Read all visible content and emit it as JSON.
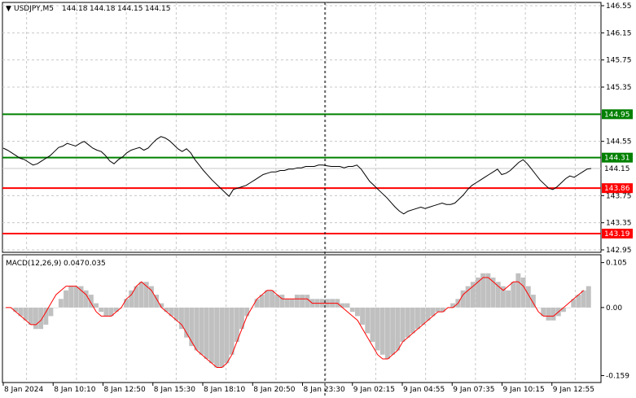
{
  "window": {
    "symbol_tf": "USDJPY,M5",
    "ohlc": [
      "144.18",
      "144.18",
      "144.15",
      "144.15"
    ]
  },
  "indicator": {
    "label": "MACD(12,26,9)",
    "values": [
      "0.047",
      "0.035"
    ]
  },
  "colors": {
    "background": "#ffffff",
    "grid": "#c8c8c8",
    "price_line": "#000000",
    "green_level": "#008000",
    "red_level": "#ff0000",
    "histogram": "#c0c0c0",
    "signal": "#ff0000"
  },
  "chart_data": [
    {
      "type": "line",
      "ylim": [
        142.95,
        146.55
      ],
      "y_ticks": [
        "146.55",
        "146.15",
        "145.75",
        "145.35",
        "144.55",
        "143.75",
        "143.35",
        "142.95"
      ],
      "x_labels": [
        "8 Jan 2024",
        "8 Jan 10:10",
        "8 Jan 12:50",
        "8 Jan 15:30",
        "8 Jan 18:10",
        "8 Jan 20:50",
        "8 Jan 23:30",
        "9 Jan 02:15",
        "9 Jan 04:55",
        "9 Jan 07:35",
        "9 Jan 10:15",
        "9 Jan 12:55"
      ],
      "current_price": "144.15",
      "levels": [
        {
          "value": 144.95,
          "label": "144.95",
          "color": "#008000"
        },
        {
          "value": 144.31,
          "label": "144.31",
          "color": "#008000"
        },
        {
          "value": 143.86,
          "label": "143.86",
          "color": "#ff0000"
        },
        {
          "value": 143.19,
          "label": "143.19",
          "color": "#ff0000"
        }
      ],
      "series": [
        {
          "values": [
            144.45,
            144.42,
            144.38,
            144.34,
            144.3,
            144.28,
            144.24,
            144.2,
            144.22,
            144.26,
            144.3,
            144.34,
            144.4,
            144.46,
            144.48,
            144.52,
            144.5,
            144.48,
            144.52,
            144.55,
            144.5,
            144.45,
            144.42,
            144.4,
            144.34,
            144.26,
            144.22,
            144.28,
            144.32,
            144.38,
            144.42,
            144.44,
            144.46,
            144.42,
            144.45,
            144.52,
            144.58,
            144.62,
            144.6,
            144.56,
            144.5,
            144.44,
            144.4,
            144.44,
            144.38,
            144.28,
            144.2,
            144.12,
            144.05,
            143.98,
            143.92,
            143.86,
            143.8,
            143.74,
            143.84,
            143.86,
            143.88,
            143.9,
            143.94,
            143.98,
            144.02,
            144.06,
            144.08,
            144.1,
            144.1,
            144.12,
            144.12,
            144.14,
            144.14,
            144.16,
            144.16,
            144.18,
            144.18,
            144.18,
            144.2,
            144.2,
            144.19,
            144.18,
            144.18,
            144.18,
            144.16,
            144.18,
            144.18,
            144.2,
            144.14,
            144.05,
            143.96,
            143.9,
            143.84,
            143.78,
            143.72,
            143.65,
            143.58,
            143.52,
            143.48,
            143.52,
            143.54,
            143.56,
            143.58,
            143.56,
            143.58,
            143.6,
            143.62,
            143.64,
            143.62,
            143.62,
            143.64,
            143.7,
            143.76,
            143.84,
            143.9,
            143.94,
            143.98,
            144.02,
            144.06,
            144.1,
            144.14,
            144.06,
            144.08,
            144.12,
            144.18,
            144.24,
            144.28,
            144.22,
            144.14,
            144.06,
            143.98,
            143.92,
            143.86,
            143.84,
            143.88,
            143.94,
            144.0,
            144.04,
            144.02,
            144.06,
            144.1,
            144.14,
            144.15
          ]
        }
      ]
    },
    {
      "type": "bar",
      "ylim": [
        -0.16,
        0.11
      ],
      "y_ticks": [
        "0.105",
        "0.00",
        "-0.159"
      ],
      "histogram": [
        0.0,
        0.0,
        -0.01,
        -0.02,
        -0.03,
        -0.04,
        -0.05,
        -0.05,
        -0.04,
        -0.02,
        0.0,
        0.02,
        0.04,
        0.05,
        0.05,
        0.05,
        0.04,
        0.03,
        0.01,
        -0.01,
        -0.02,
        -0.02,
        -0.01,
        0.0,
        0.02,
        0.04,
        0.05,
        0.06,
        0.06,
        0.05,
        0.03,
        0.01,
        -0.01,
        -0.02,
        -0.03,
        -0.05,
        -0.07,
        -0.09,
        -0.1,
        -0.11,
        -0.12,
        -0.13,
        -0.14,
        -0.14,
        -0.13,
        -0.11,
        -0.08,
        -0.05,
        -0.02,
        0.0,
        0.02,
        0.03,
        0.04,
        0.04,
        0.03,
        0.03,
        0.02,
        0.02,
        0.03,
        0.03,
        0.03,
        0.02,
        0.02,
        0.02,
        0.02,
        0.02,
        0.02,
        0.01,
        0.01,
        -0.01,
        -0.02,
        -0.04,
        -0.06,
        -0.08,
        -0.1,
        -0.11,
        -0.12,
        -0.11,
        -0.1,
        -0.08,
        -0.07,
        -0.06,
        -0.05,
        -0.04,
        -0.03,
        -0.02,
        -0.01,
        -0.01,
        0.0,
        0.01,
        0.02,
        0.04,
        0.05,
        0.06,
        0.07,
        0.08,
        0.08,
        0.07,
        0.06,
        0.05,
        0.04,
        0.06,
        0.08,
        0.07,
        0.05,
        0.03,
        0.0,
        -0.02,
        -0.03,
        -0.03,
        -0.02,
        -0.01,
        0.0,
        0.02,
        0.03,
        0.04,
        0.05
      ],
      "signal": [
        0.0,
        0.0,
        -0.01,
        -0.02,
        -0.03,
        -0.04,
        -0.04,
        -0.03,
        -0.01,
        0.01,
        0.03,
        0.04,
        0.05,
        0.05,
        0.05,
        0.04,
        0.03,
        0.01,
        -0.01,
        -0.02,
        -0.02,
        -0.02,
        -0.01,
        0.0,
        0.02,
        0.03,
        0.05,
        0.06,
        0.05,
        0.04,
        0.02,
        0.0,
        -0.01,
        -0.02,
        -0.03,
        -0.04,
        -0.06,
        -0.08,
        -0.1,
        -0.11,
        -0.12,
        -0.13,
        -0.14,
        -0.14,
        -0.13,
        -0.11,
        -0.08,
        -0.05,
        -0.02,
        0.0,
        0.02,
        0.03,
        0.04,
        0.04,
        0.03,
        0.02,
        0.02,
        0.02,
        0.02,
        0.02,
        0.02,
        0.01,
        0.01,
        0.01,
        0.01,
        0.01,
        0.01,
        0.0,
        -0.01,
        -0.02,
        -0.03,
        -0.05,
        -0.07,
        -0.09,
        -0.11,
        -0.12,
        -0.12,
        -0.11,
        -0.1,
        -0.08,
        -0.07,
        -0.06,
        -0.05,
        -0.04,
        -0.03,
        -0.02,
        -0.01,
        -0.01,
        0.0,
        0.0,
        0.01,
        0.03,
        0.04,
        0.05,
        0.06,
        0.07,
        0.07,
        0.06,
        0.05,
        0.04,
        0.05,
        0.06,
        0.06,
        0.05,
        0.03,
        0.01,
        -0.01,
        -0.02,
        -0.02,
        -0.02,
        -0.01,
        0.0,
        0.01,
        0.02,
        0.03,
        0.04
      ]
    }
  ]
}
